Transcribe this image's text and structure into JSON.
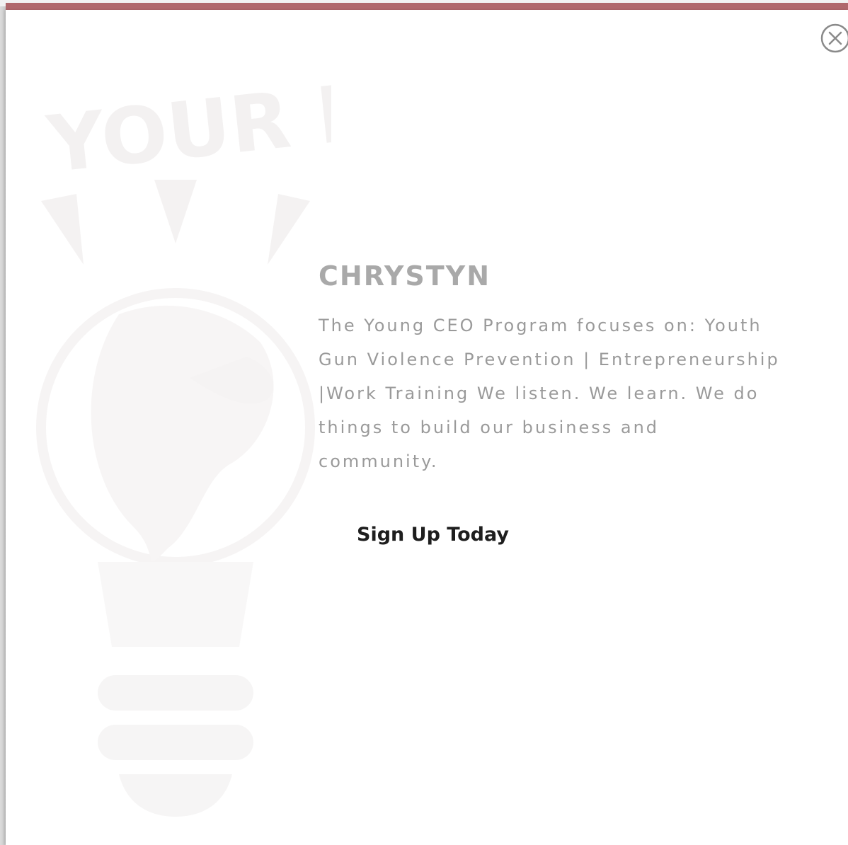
{
  "colors": {
    "accent_bar": "#b0686c",
    "heading": "#a9a9a9",
    "body_text": "#9a9a9a",
    "cta_text": "#1e1e1e",
    "watermark": "#f4f2f2"
  },
  "modal": {
    "close_icon": "close-circle-icon",
    "watermark_icon": "lightbulb-globe-icon",
    "watermark_text": "YOUR ID",
    "heading": "CHRYSTYN",
    "body": "The Young CEO Program focuses on: Youth Gun Violence Prevention | Entrepreneurship |Work Training We listen. We learn. We do things to build our business and community.",
    "cta_label": "Sign Up Today"
  }
}
